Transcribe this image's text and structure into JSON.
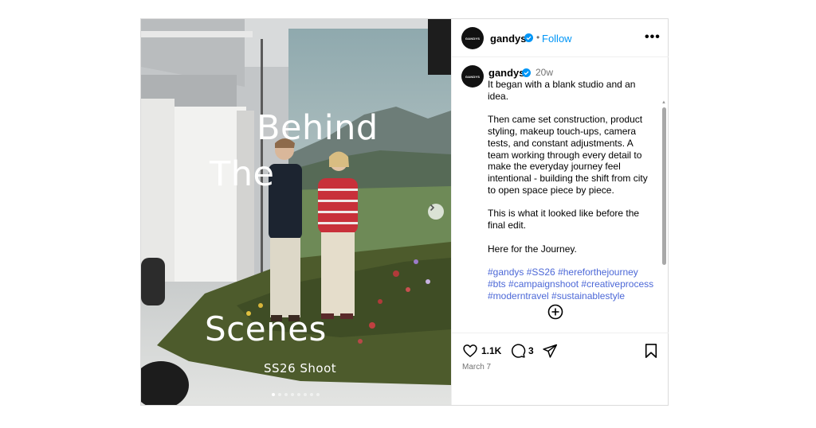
{
  "post": {
    "media": {
      "title_line1": "Behind",
      "title_line2": "The",
      "title_line3": "Scenes",
      "subtitle": "SS26 Shoot",
      "carousel_count": 8,
      "carousel_active_index": 0
    },
    "header": {
      "avatar_text": "GANDYS",
      "username": "gandys",
      "separator": "•",
      "follow_label": "Follow",
      "more_label": "•••"
    },
    "caption": {
      "avatar_text": "GANDYS",
      "username": "gandys",
      "time": "20w",
      "paragraphs": [
        "It began with a blank studio and an idea.",
        "Then came set construction, product styling, makeup touch-ups, camera tests, and constant adjustments. A team working through every detail to make the everyday journey feel intentional - building the shift from city to open space piece by piece.",
        "This is what it looked like before the final edit.",
        "Here for the Journey."
      ],
      "hashtags": "#gandys #SS26 #hereforthejourney #bts #campaignshoot #creativeprocess #moderntravel #sustainablestyle"
    },
    "actions": {
      "likes": "1.1K",
      "comments": "3",
      "date": "March 7"
    }
  },
  "colors": {
    "accent": "#0095f6",
    "hashtag": "#4c68d7",
    "muted": "#737373",
    "verified": "#0095f6"
  },
  "icons": [
    "verified-badge-icon",
    "more-icon",
    "add-comment-icon",
    "heart-icon",
    "comment-icon",
    "share-icon",
    "bookmark-icon",
    "chevron-right-icon"
  ]
}
